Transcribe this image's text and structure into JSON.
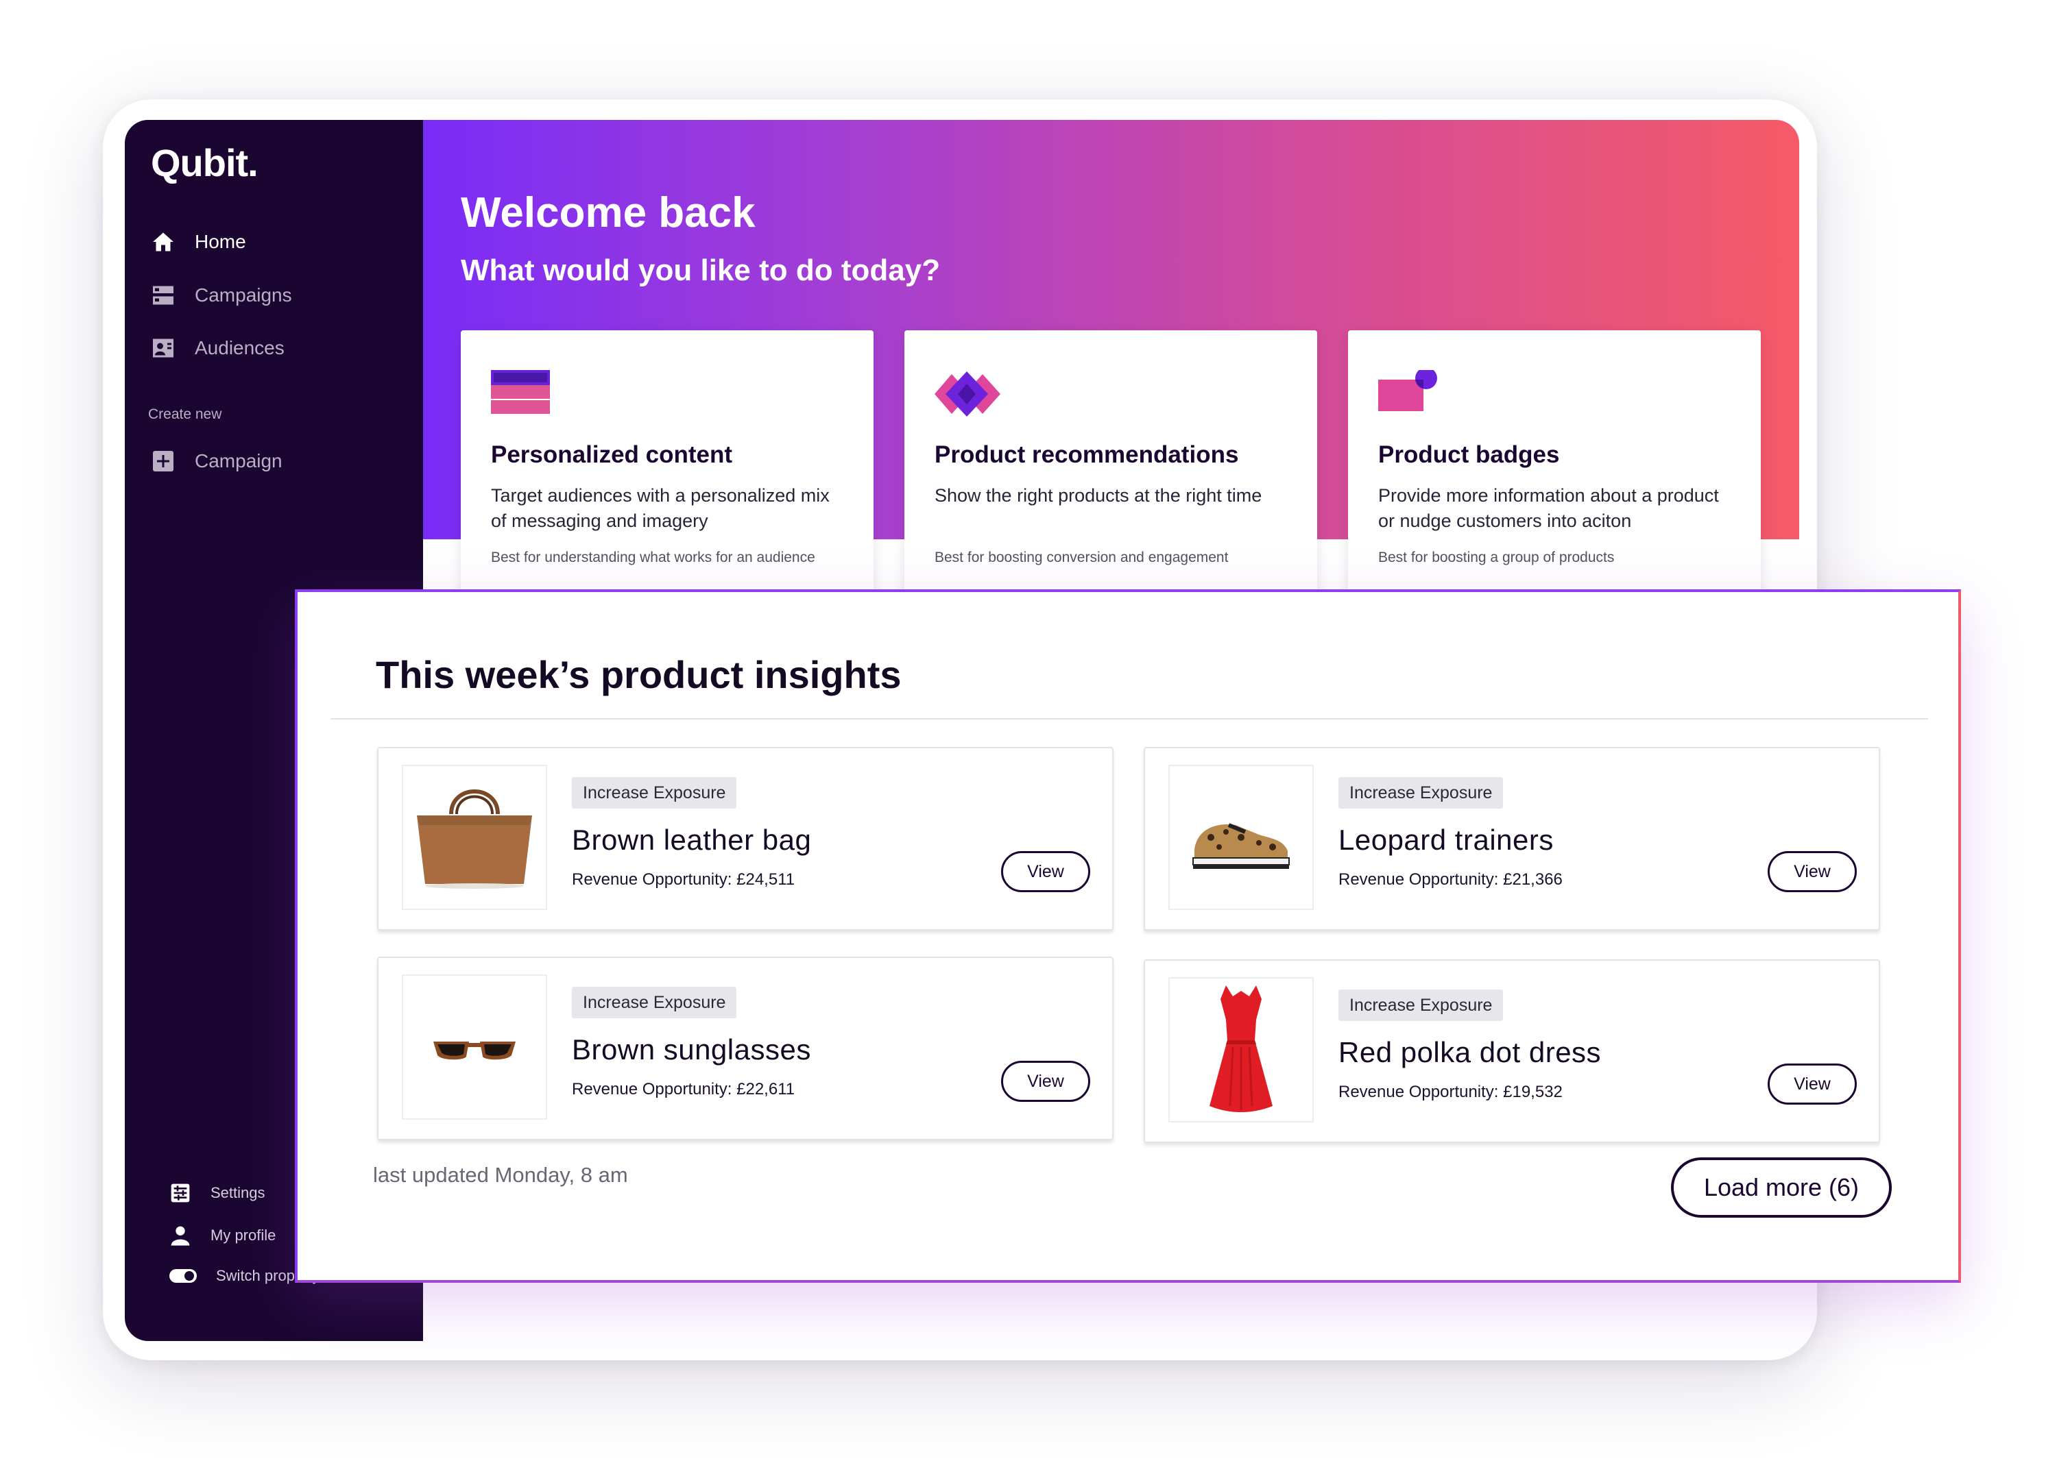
{
  "app": {
    "logo": "Qubit."
  },
  "sidebar": {
    "nav": [
      {
        "label": "Home",
        "icon": "home-icon",
        "active": true
      },
      {
        "label": "Campaigns",
        "icon": "campaigns-icon",
        "active": false
      },
      {
        "label": "Audiences",
        "icon": "audiences-icon",
        "active": false
      }
    ],
    "create_new_label": "Create new",
    "create_items": [
      {
        "label": "Campaign",
        "icon": "plus-square-icon"
      }
    ],
    "footer": [
      {
        "label": "Settings",
        "icon": "settings-icon"
      },
      {
        "label": "My profile",
        "icon": "profile-icon"
      },
      {
        "label": "Switch property",
        "icon": "toggle-icon"
      }
    ]
  },
  "hero": {
    "title": "Welcome back",
    "subtitle": "What would you like to do today?",
    "colors": {
      "gradient_start": "#7a2cf7",
      "gradient_end": "#f65a67"
    }
  },
  "campaign_types": [
    {
      "title": "Personalized content",
      "description": "Target audiences with a personalized mix of messaging and imagery",
      "note": "Best for understanding what works for an audience",
      "icon": "stacked-cards-icon"
    },
    {
      "title": "Product recommendations",
      "description": "Show the right products at the right time",
      "note": "Best for boosting conversion and engagement",
      "icon": "diamonds-icon"
    },
    {
      "title": "Product badges",
      "description": "Provide more information about a product or nudge customers into aciton",
      "note": "Best for boosting a group of products",
      "icon": "badge-icon"
    }
  ],
  "insights": {
    "title": "This week’s product insights",
    "products": [
      {
        "tag": "Increase Exposure",
        "name": "Brown leather bag",
        "revenue": "Revenue Opportunity: £24,511",
        "button": "View",
        "image": "bag-image"
      },
      {
        "tag": "Increase Exposure",
        "name": "Leopard trainers",
        "revenue": "Revenue Opportunity: £21,366",
        "button": "View",
        "image": "trainers-image"
      },
      {
        "tag": "Increase Exposure",
        "name": "Brown sunglasses",
        "revenue": "Revenue Opportunity: £22,611",
        "button": "View",
        "image": "sunglasses-image"
      },
      {
        "tag": "Increase Exposure",
        "name": "Red polka dot dress",
        "revenue": "Revenue Opportunity: £19,532",
        "button": "View",
        "image": "dress-image"
      }
    ],
    "last_updated": "last updated Monday, 8 am",
    "load_more": "Load more (6)"
  }
}
